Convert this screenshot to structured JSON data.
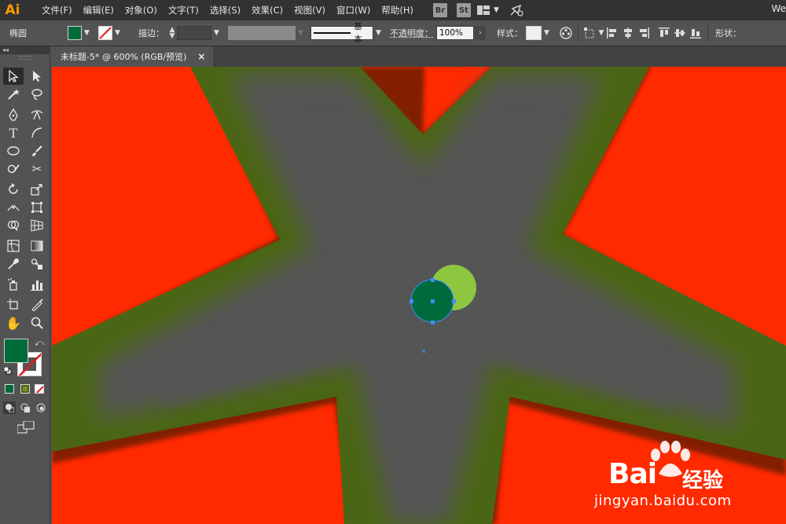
{
  "app": {
    "logo": "Ai",
    "window_title": "We",
    "menu": [
      "文件(F)",
      "编辑(E)",
      "对象(O)",
      "文字(T)",
      "选择(S)",
      "效果(C)",
      "视图(V)",
      "窗口(W)",
      "帮助(H)"
    ],
    "bridge_badge": "Br",
    "stock_badge": "St"
  },
  "control_bar": {
    "object_type": "椭圆",
    "fill_color": "#006b3a",
    "stroke_label": "描边：",
    "stroke_profile": "基本",
    "opacity_label": "不透明度：",
    "opacity_value": "100%",
    "style_label": "样式：",
    "shape_label": "形状："
  },
  "document": {
    "tab_title": "未标题-5* @ 600% (RGB/预览)",
    "close_glyph": "×"
  },
  "toolbar": {
    "fill_color": "#006b3a"
  },
  "canvas_colors": {
    "background": "#ff2a00",
    "star_outer": "#4a6614",
    "star_inner": "#555555",
    "circle_dark": "#006b3a",
    "circle_light": "#8dc63f",
    "selection": "#3f8dff"
  },
  "watermark": {
    "brand": "Bai",
    "brand_cn": "经验",
    "url": "jingyan.baidu.com"
  }
}
